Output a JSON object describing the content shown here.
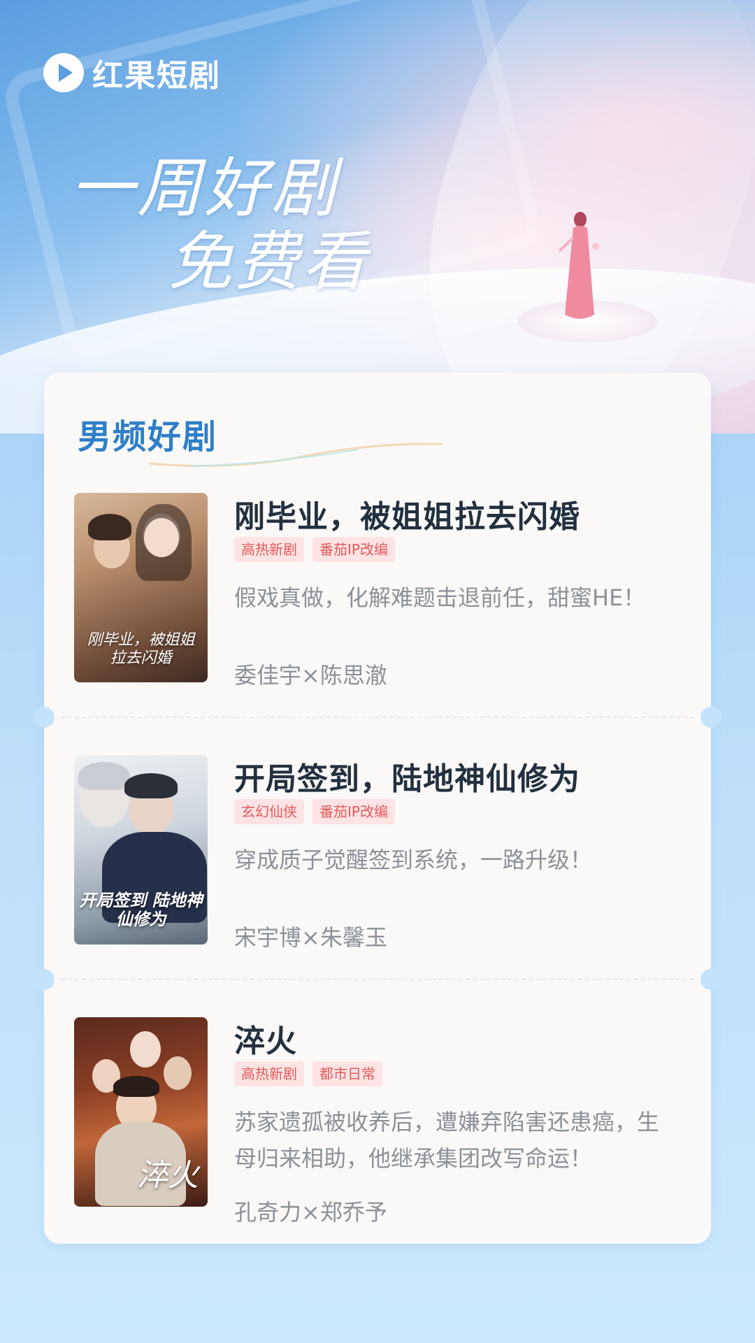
{
  "brand": {
    "name": "红果短剧"
  },
  "hero": {
    "headline_line1": "一周好剧",
    "headline_line2": "免费看"
  },
  "section": {
    "title": "男频好剧"
  },
  "dramas": [
    {
      "title": "刚毕业，被姐姐拉去闪婚",
      "tags": [
        "高热新剧",
        "番茄IP改编"
      ],
      "description": "假戏真做，化解难题击退前任，甜蜜HE！",
      "cast": "委佳宇×陈思澈",
      "poster_caption": "刚毕业，被姐姐拉去闪婚"
    },
    {
      "title": "开局签到，陆地神仙修为",
      "tags": [
        "玄幻仙侠",
        "番茄IP改编"
      ],
      "description": "穿成质子觉醒签到系统，一路升级！",
      "cast": "宋宇博×朱馨玉",
      "poster_caption": "开局签到 陆地神仙修为"
    },
    {
      "title": "淬火",
      "tags": [
        "高热新剧",
        "都市日常"
      ],
      "description": "苏家遗孤被收养后，遭嫌弃陷害还患癌，生母归来相助，他继承集团改写命运！",
      "cast": "孔奇力×郑乔予",
      "poster_caption": "淬火"
    }
  ],
  "colors": {
    "brand_blue": "#2f7fc8",
    "tag_bg": "#fde3e3",
    "tag_text": "#e35b5b",
    "title_text": "#22303f",
    "muted_text": "#8b9199"
  }
}
